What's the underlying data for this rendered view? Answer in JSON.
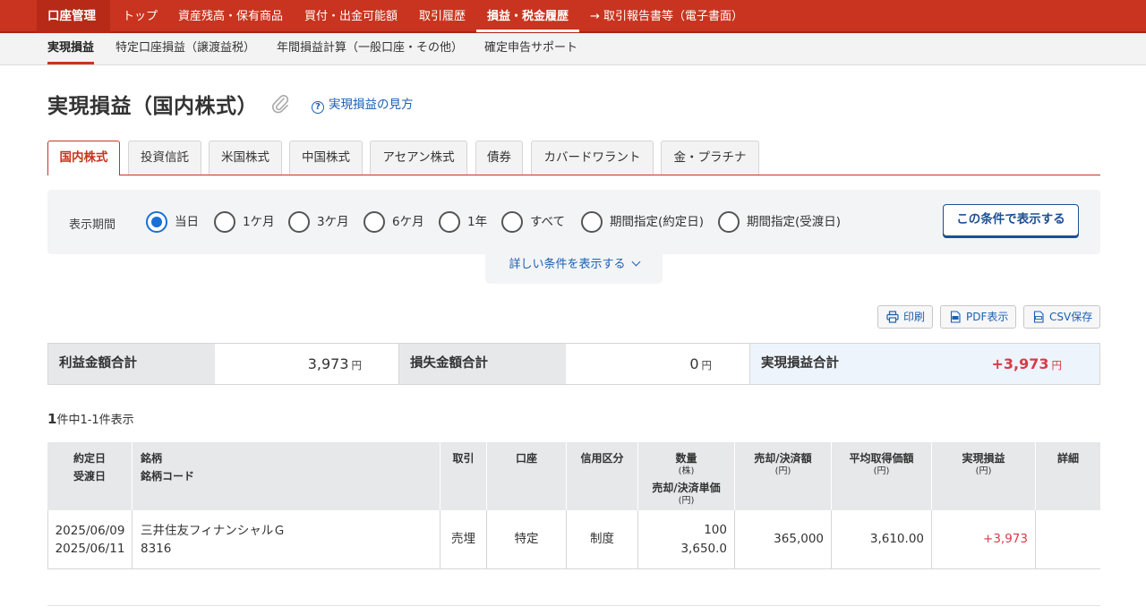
{
  "topnav": {
    "account": "口座管理",
    "items": [
      "トップ",
      "資産残高・保有商品",
      "買付・出金可能額",
      "取引履歴",
      "損益・税金履歴",
      "取引報告書等（電子書面）"
    ],
    "active": "損益・税金履歴",
    "report_arrow": "→"
  },
  "subnav": {
    "items": [
      "実現損益",
      "特定口座損益（譲渡益税）",
      "年間損益計算（一般口座・その他）",
      "確定申告サポート"
    ],
    "active": "実現損益"
  },
  "page": {
    "title": "実現損益（国内株式）",
    "help_link": "実現損益の見方",
    "help_icon": "question-circle-icon",
    "attach_icon": "paperclip-icon"
  },
  "product_tabs": [
    "国内株式",
    "投資信託",
    "米国株式",
    "中国株式",
    "アセアン株式",
    "債券",
    "カバードワラント",
    "金・プラチナ"
  ],
  "filter": {
    "label": "表示期間",
    "options": [
      "当日",
      "1ケ月",
      "3ケ月",
      "6ケ月",
      "1年",
      "すべて",
      "期間指定(約定日)",
      "期間指定(受渡日)"
    ],
    "selected": "当日",
    "submit": "この条件で表示する",
    "more": "詳しい条件を表示する"
  },
  "tools": {
    "print": "印刷",
    "pdf": "PDF表示",
    "csv": "CSV保存"
  },
  "summary": {
    "profit_label": "利益金額合計",
    "profit_value": "3,973",
    "loss_label": "損失金額合計",
    "loss_value": "0",
    "total_label": "実現損益合計",
    "total_value": "+3,973",
    "yen": "円"
  },
  "count": {
    "total": "1",
    "text": "件中1-1件表示"
  },
  "table": {
    "headers": {
      "date1": "約定日",
      "date2": "受渡日",
      "name1": "銘柄",
      "name2": "銘柄コード",
      "trade": "取引",
      "account": "口座",
      "credit": "信用区分",
      "qty": "数量",
      "qty_unit": "(株)",
      "price": "売却/決済単価",
      "price_unit": "(円)",
      "amount": "売却/決済額",
      "amount_unit": "(円)",
      "avg": "平均取得価額",
      "avg_unit": "(円)",
      "pl": "実現損益",
      "pl_unit": "(円)",
      "detail": "詳細"
    },
    "rows": [
      {
        "trade_date": "2025/06/09",
        "settle_date": "2025/06/11",
        "name": "三井住友フィナンシャルＧ",
        "code": "8316",
        "trade": "売埋",
        "account": "特定",
        "credit": "制度",
        "qty": "100",
        "price": "3,650.0",
        "amount": "365,000",
        "avg": "3,610.00",
        "pl": "+3,973"
      }
    ]
  },
  "colors": {
    "brand_red": "#c8341f",
    "link_blue": "#1a5fb4",
    "gain_red": "#d93a49"
  }
}
